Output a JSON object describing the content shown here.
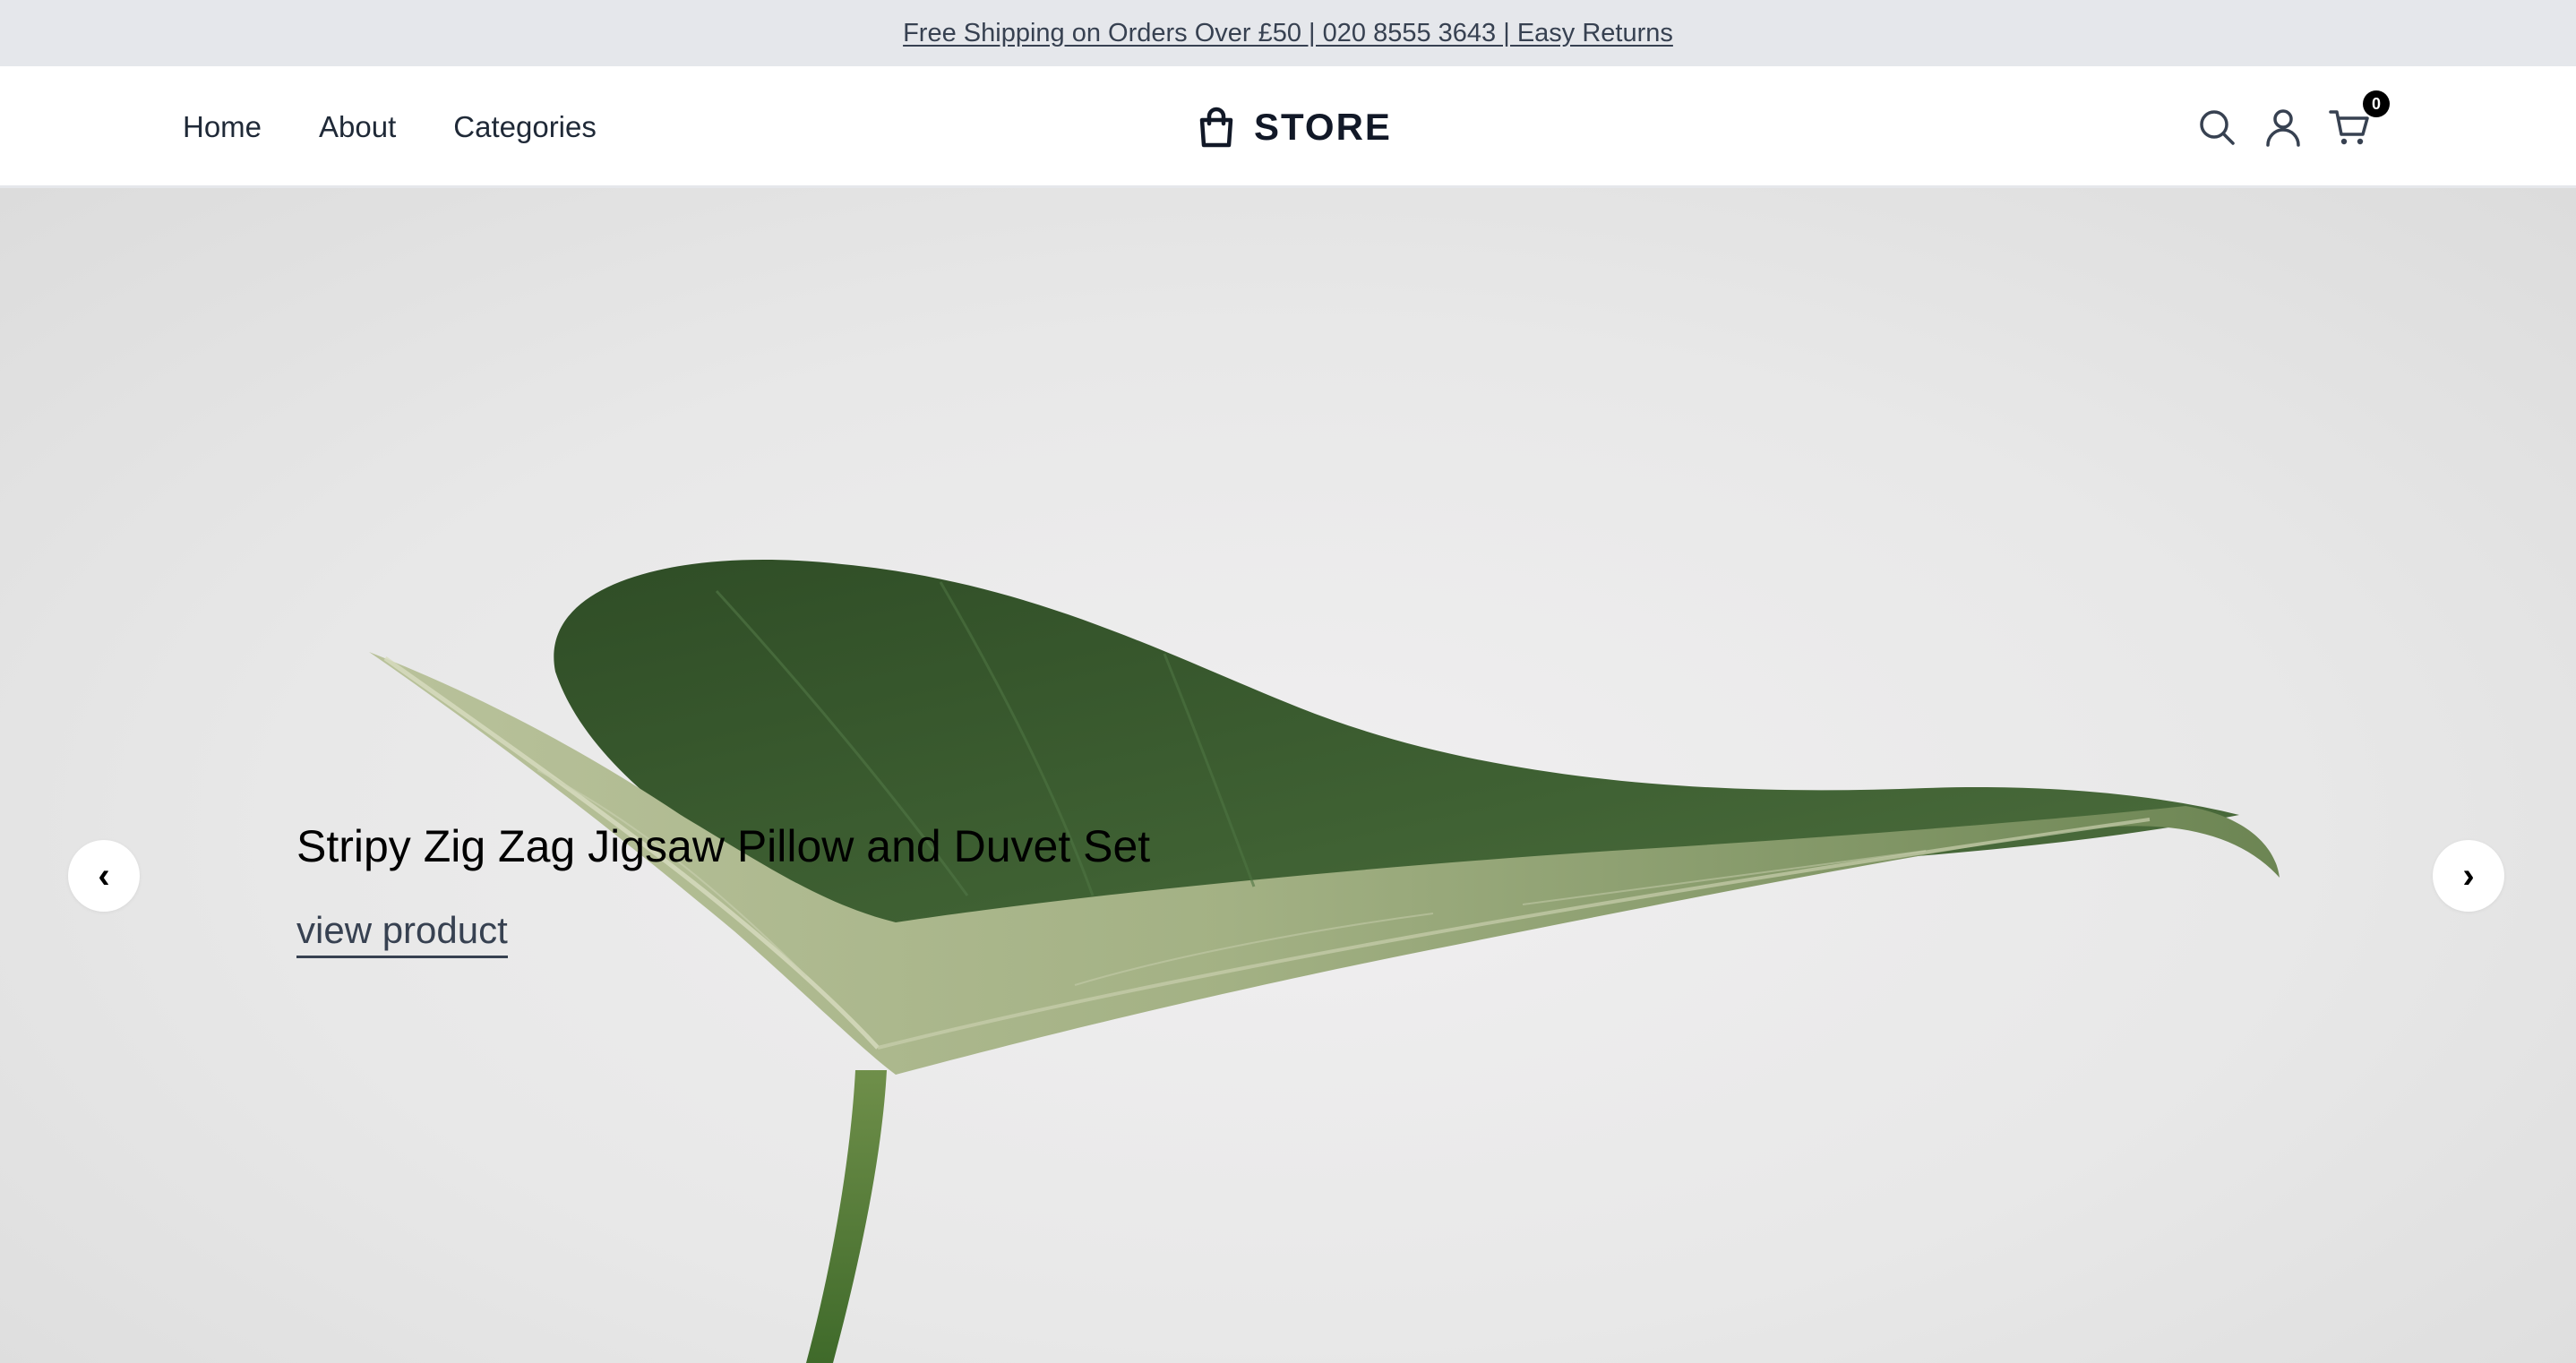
{
  "announcement": {
    "text": "Free Shipping on Orders Over £50 | 020 8555 3643 | Easy Returns"
  },
  "nav": {
    "links": [
      {
        "label": "Home"
      },
      {
        "label": "About"
      },
      {
        "label": "Categories"
      }
    ]
  },
  "logo": {
    "text": "STORE",
    "icon": "shopping-bag-icon"
  },
  "header_icons": {
    "search": "search-icon",
    "account": "user-icon",
    "cart": "cart-icon",
    "cart_count": "0"
  },
  "hero": {
    "title": "Stripy Zig Zag Jigsaw Pillow and Duvet Set",
    "link_label": "view product",
    "prev_label": "‹",
    "next_label": "›"
  },
  "colors": {
    "announcement_bg": "#e5e7eb",
    "text_dark": "#1f2937",
    "leaf_dark": "#3f5e32",
    "leaf_light": "#9bab7e",
    "hero_bg": "#e8e8e8"
  }
}
